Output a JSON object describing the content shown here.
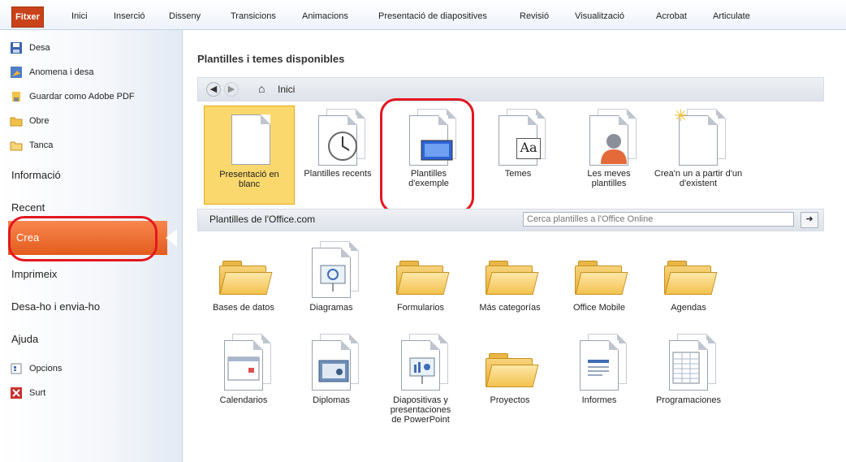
{
  "ribbon": {
    "tabs": [
      "Fitxer",
      "Inici",
      "Inserció",
      "Disseny",
      "Transicions",
      "Animacions",
      "Presentació de diapositives",
      "Revisió",
      "Visualització",
      "Acrobat",
      "Articulate"
    ]
  },
  "backstage": {
    "small_items": [
      "Desa",
      "Anomena i desa",
      "Guardar como Adobe PDF",
      "Obre",
      "Tanca"
    ],
    "big_items": [
      "Informació",
      "Recent",
      "Crea",
      "Imprimeix",
      "Desa-ho i envia-ho",
      "Ajuda"
    ],
    "bottom_items": [
      "Opcions",
      "Surt"
    ]
  },
  "main": {
    "title": "Plantilles i temes disponibles",
    "nav_label": "Inici",
    "tiles": [
      {
        "label": "Presentació en blanc"
      },
      {
        "label": "Plantilles recents"
      },
      {
        "label": "Plantilles d'exemple"
      },
      {
        "label": "Temes"
      },
      {
        "label": "Les meves plantilles"
      },
      {
        "label": "Crea'n un a partir d'un d'existent"
      }
    ],
    "office_section": "Plantilles de l'Office.com",
    "search_placeholder": "Cerca plantilles a l'Office Online",
    "office_row1": [
      "Bases de datos",
      "Diagramas",
      "Formularios",
      "Más categorías",
      "Office Mobile",
      "Agendas"
    ],
    "office_row2": [
      "Calendarios",
      "Diplomas",
      "Diapositivas y presentaciones de PowerPoint",
      "Proyectos",
      "Informes",
      "Programaciones"
    ]
  },
  "colors": {
    "accent_orange": "#e35b1e",
    "file_tab": "#c9421a",
    "selected_tile": "#fbd86d",
    "highlight_circle": "#e3171f"
  }
}
